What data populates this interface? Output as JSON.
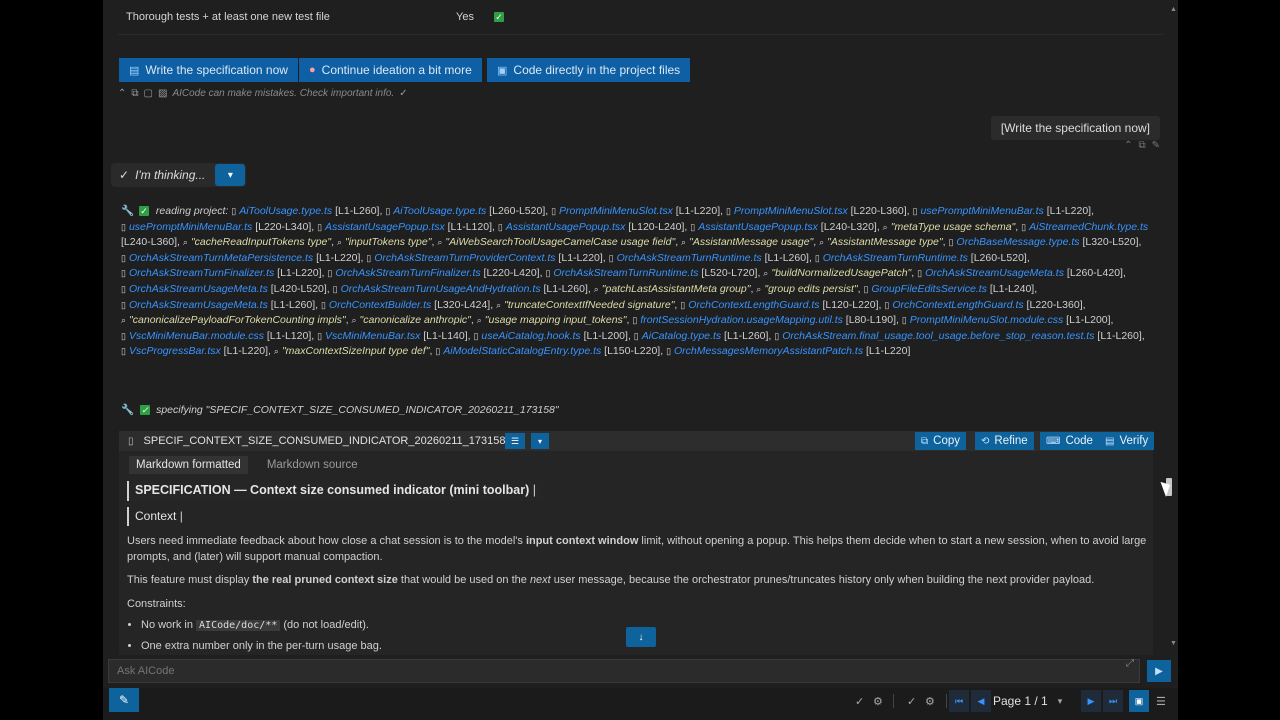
{
  "table_row": {
    "text": "Thorough tests + at least one new test file",
    "value": "Yes"
  },
  "actions": [
    {
      "label": "Write the specification now",
      "icon": "doc-icon"
    },
    {
      "label": "Continue ideation a bit more",
      "icon": "brain-icon"
    },
    {
      "label": "Code directly in the project files",
      "icon": "code-icon"
    }
  ],
  "disclaimer": "AICode can make mistakes. Check important info.",
  "user_message": "[Write the specification now]",
  "thinking_label": "I'm thinking...",
  "reading": {
    "label": "reading project:",
    "items": [
      {
        "t": "f",
        "n": "AiToolUsage.type.ts",
        "r": "[L1-L260],"
      },
      {
        "t": "f",
        "n": "AiToolUsage.type.ts",
        "r": "[L260-L520],"
      },
      {
        "t": "f",
        "n": "PromptMiniMenuSlot.tsx",
        "r": "[L1-L220],"
      },
      {
        "t": "f",
        "n": "PromptMiniMenuSlot.tsx",
        "r": "[L220-L360],"
      },
      {
        "t": "f",
        "n": "usePromptMiniMenuBar.ts",
        "r": "[L1-L220],"
      },
      {
        "t": "f",
        "n": "usePromptMiniMenuBar.ts",
        "r": "[L220-L340],"
      },
      {
        "t": "f",
        "n": "AssistantUsagePopup.tsx",
        "r": "[L1-L120],"
      },
      {
        "t": "f",
        "n": "AssistantUsagePopup.tsx",
        "r": "[L120-L240],"
      },
      {
        "t": "f",
        "n": "AssistantUsagePopup.tsx",
        "r": "[L240-L320],"
      },
      {
        "t": "s",
        "n": "\"metaType usage schema\"",
        "r": ","
      },
      {
        "t": "f",
        "n": "AiStreamedChunk.type.ts",
        "r": "[L240-L360],"
      },
      {
        "t": "s",
        "n": "\"cacheReadInputTokens type\"",
        "r": ","
      },
      {
        "t": "s",
        "n": "\"inputTokens type\"",
        "r": ","
      },
      {
        "t": "s",
        "n": "\"AiWebSearchToolUsageCamelCase usage field\"",
        "r": ","
      },
      {
        "t": "s",
        "n": "\"AssistantMessage usage\"",
        "r": ","
      },
      {
        "t": "s",
        "n": "\"AssistantMessage type\"",
        "r": ","
      },
      {
        "t": "f",
        "n": "OrchBaseMessage.type.ts",
        "r": "[L320-L520],"
      },
      {
        "t": "f",
        "n": "OrchAskStreamTurnMetaPersistence.ts",
        "r": "[L1-L220],"
      },
      {
        "t": "f",
        "n": "OrchAskStreamTurnProviderContext.ts",
        "r": "[L1-L220],"
      },
      {
        "t": "f",
        "n": "OrchAskStreamTurnRuntime.ts",
        "r": "[L1-L260],"
      },
      {
        "t": "f",
        "n": "OrchAskStreamTurnRuntime.ts",
        "r": "[L260-L520],"
      },
      {
        "t": "f",
        "n": "OrchAskStreamTurnFinalizer.ts",
        "r": "[L1-L220],"
      },
      {
        "t": "f",
        "n": "OrchAskStreamTurnFinalizer.ts",
        "r": "[L220-L420],"
      },
      {
        "t": "f",
        "n": "OrchAskStreamTurnRuntime.ts",
        "r": "[L520-L720],"
      },
      {
        "t": "s",
        "n": "\"buildNormalizedUsagePatch\"",
        "r": ","
      },
      {
        "t": "f",
        "n": "OrchAskStreamUsageMeta.ts",
        "r": "[L260-L420],"
      },
      {
        "t": "f",
        "n": "OrchAskStreamUsageMeta.ts",
        "r": "[L420-L520],"
      },
      {
        "t": "f",
        "n": "OrchAskStreamTurnUsageAndHydration.ts",
        "r": "[L1-L260],"
      },
      {
        "t": "s",
        "n": "\"patchLastAssistantMeta group\"",
        "r": ","
      },
      {
        "t": "s",
        "n": "\"group edits persist\"",
        "r": ","
      },
      {
        "t": "f",
        "n": "GroupFileEditsService.ts",
        "r": "[L1-L240],"
      },
      {
        "t": "f",
        "n": "OrchAskStreamUsageMeta.ts",
        "r": "[L1-L260],"
      },
      {
        "t": "f",
        "n": "OrchContextBuilder.ts",
        "r": "[L320-L424],"
      },
      {
        "t": "s",
        "n": "\"truncateContextIfNeeded signature\"",
        "r": ","
      },
      {
        "t": "f",
        "n": "OrchContextLengthGuard.ts",
        "r": "[L120-L220],"
      },
      {
        "t": "f",
        "n": "OrchContextLengthGuard.ts",
        "r": "[L220-L360],"
      },
      {
        "t": "s",
        "n": "\"canonicalizePayloadForTokenCounting impls\"",
        "r": ","
      },
      {
        "t": "s",
        "n": "\"canonicalize anthropic\"",
        "r": ","
      },
      {
        "t": "s",
        "n": "\"usage mapping input_tokens\"",
        "r": ","
      },
      {
        "t": "f",
        "n": "frontSessionHydration.usageMapping.util.ts",
        "r": "[L80-L190],"
      },
      {
        "t": "f",
        "n": "PromptMiniMenuSlot.module.css",
        "r": "[L1-L200],"
      },
      {
        "t": "f",
        "n": "VscMiniMenuBar.module.css",
        "r": "[L1-L120],"
      },
      {
        "t": "f",
        "n": "VscMiniMenuBar.tsx",
        "r": "[L1-L140],"
      },
      {
        "t": "f",
        "n": "useAiCatalog.hook.ts",
        "r": "[L1-L200],"
      },
      {
        "t": "f",
        "n": "AiCatalog.type.ts",
        "r": "[L1-L260],"
      },
      {
        "t": "f",
        "n": "OrchAskStream.final_usage.tool_usage.before_stop_reason.test.ts",
        "r": "[L1-L260],"
      },
      {
        "t": "f",
        "n": "VscProgressBar.tsx",
        "r": "[L1-L220],"
      },
      {
        "t": "s",
        "n": "\"maxContextSizeInput type def\"",
        "r": ","
      },
      {
        "t": "f",
        "n": "AiModelStaticCatalogEntry.type.ts",
        "r": "[L150-L220],"
      },
      {
        "t": "f",
        "n": "OrchMessagesMemoryAssistantPatch.ts",
        "r": "[L1-L220]"
      }
    ]
  },
  "specifying": "specifying \"SPECIF_CONTEXT_SIZE_CONSUMED_INDICATOR_20260211_173158\"",
  "sheet": {
    "title": "SPECIF_CONTEXT_SIZE_CONSUMED_INDICATOR_20260211_173158",
    "buttons": {
      "copy": "Copy",
      "refine": "Refine",
      "code": "Code",
      "verify": "Verify"
    },
    "tabs": {
      "formatted": "Markdown formatted",
      "source": "Markdown source"
    },
    "h1": "SPECIFICATION — Context size consumed indicator (mini toolbar)",
    "h2": "Context",
    "p1_a": "Users need immediate feedback about how close a chat session is to the model's ",
    "p1_b": "input context window",
    "p1_c": " limit, without opening a popup. This helps them decide when to start a new session, when to avoid large prompts, and (later) will support manual compaction.",
    "p2_a": "This feature must display ",
    "p2_b": "the real pruned context size",
    "p2_c": " that would be used on the ",
    "p2_d": "next",
    "p2_e": " user message, because the orchestrator prunes/truncates history only when building the next provider payload.",
    "p3": "Constraints:",
    "li1_a": "No work in ",
    "li1_code": "AICode/doc/**",
    "li1_b": " (do not load/edit).",
    "li2": "One extra number only in the per-turn usage bag."
  },
  "input_placeholder": "Ask AICode",
  "pager_label": "Page 1 / 1",
  "colors": {
    "accent": "#0e639c",
    "link": "#3794ff",
    "check": "#2ea043",
    "panel": "#1f1f1f"
  }
}
